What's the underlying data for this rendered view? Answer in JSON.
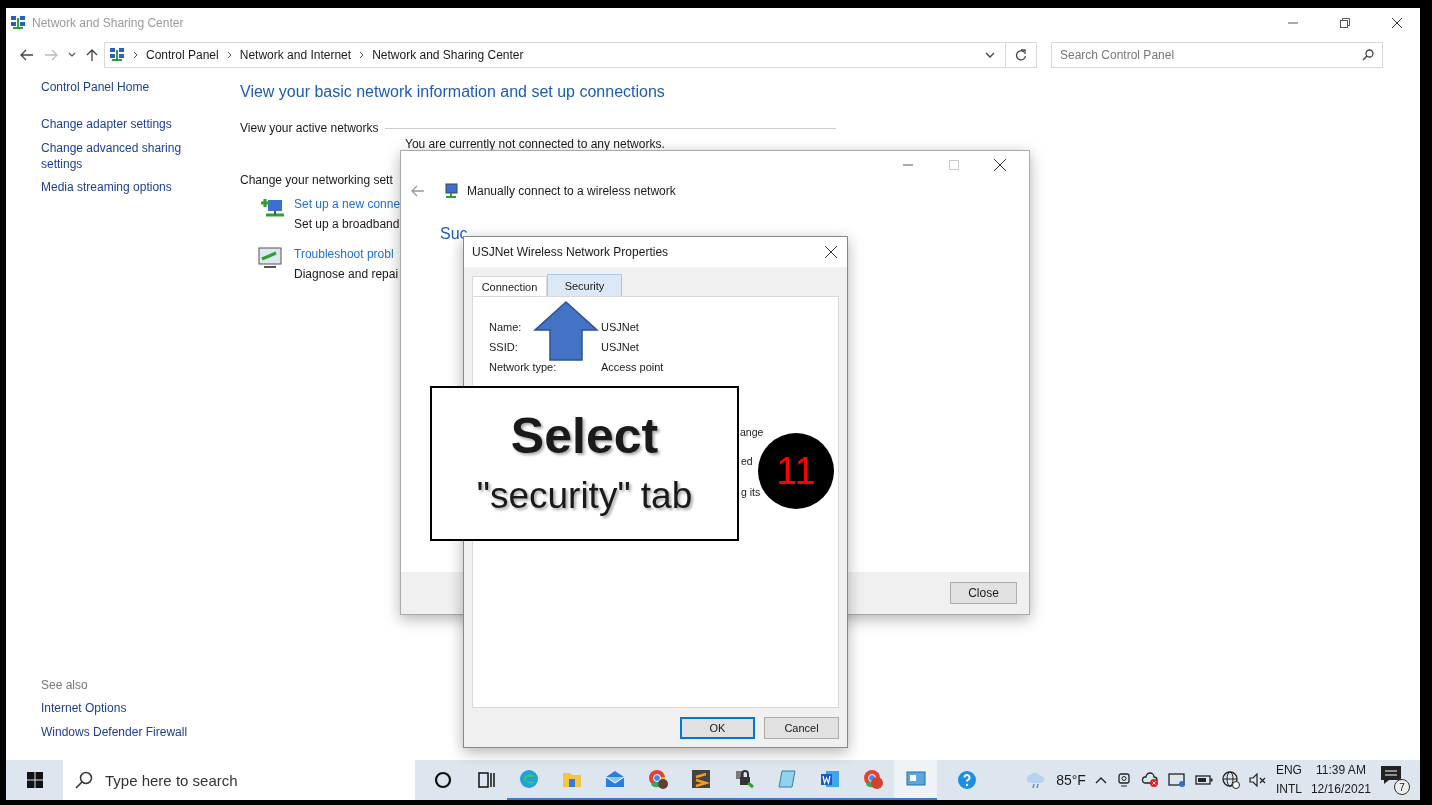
{
  "window": {
    "title": "Network and Sharing Center"
  },
  "address_bar": {
    "path": [
      "Control Panel",
      "Network and Internet",
      "Network and Sharing Center"
    ]
  },
  "search": {
    "placeholder": "Search Control Panel"
  },
  "sidebar": {
    "items": [
      "Control Panel Home",
      "Change adapter settings",
      "Change advanced sharing settings",
      "Media streaming options"
    ],
    "see_also_heading": "See also",
    "see_also": [
      "Internet Options",
      "Windows Defender Firewall"
    ]
  },
  "main": {
    "heading": "View your basic network information and set up connections",
    "active_networks_label": "View your active networks",
    "status": "You are currently not connected to any networks.",
    "change_label": "Change your networking sett",
    "tasks": [
      {
        "link": "Set up a new conne",
        "description": "Set up a broadband"
      },
      {
        "link": "Troubleshoot probl",
        "description": "Diagnose and repai"
      }
    ]
  },
  "wizard": {
    "title": "Manually connect to a wireless network",
    "heading": "Suc",
    "button": "Close"
  },
  "properties": {
    "title": "USJNet Wireless Network Properties",
    "tabs": [
      {
        "label": "Connection",
        "selected": true,
        "hovered": false
      },
      {
        "label": "Security",
        "selected": false,
        "hovered": true
      }
    ],
    "fields": [
      {
        "label": "Name:",
        "value": "USJNet"
      },
      {
        "label": "SSID:",
        "value": "USJNet"
      },
      {
        "label": "Network type:",
        "value": "Access point"
      }
    ],
    "fragments": [
      "ange",
      "ed",
      "g its"
    ],
    "buttons": [
      {
        "label": "OK",
        "default": true
      },
      {
        "label": "Cancel",
        "default": false
      }
    ]
  },
  "callout": {
    "title": "Select",
    "text": "\"security\" tab",
    "step": "11"
  },
  "taskbar": {
    "search_placeholder": "Type here to search",
    "weather": "85°F",
    "language": [
      "ENG",
      "INTL"
    ],
    "time": "11:39 AM",
    "date": "12/16/2021",
    "notifications": "7"
  }
}
